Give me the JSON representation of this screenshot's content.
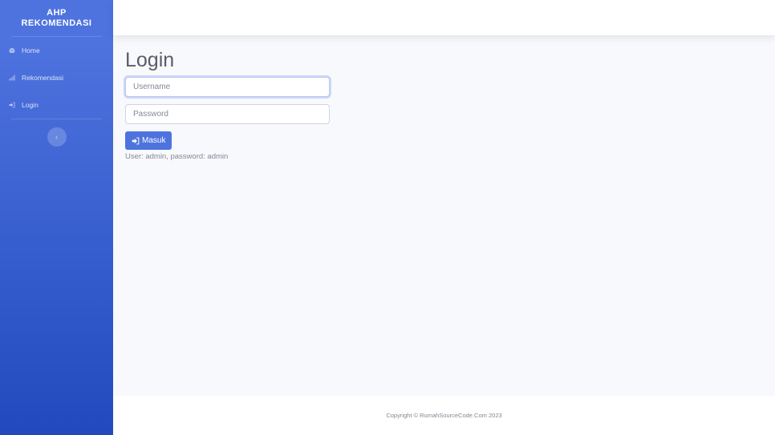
{
  "brand": {
    "line1": "AHP",
    "line2": "REKOMENDASI"
  },
  "sidebar": {
    "items": [
      {
        "label": "Home",
        "icon": "dashboard-icon"
      },
      {
        "label": "Rekomendasi",
        "icon": "signal-bars-icon"
      },
      {
        "label": "Login",
        "icon": "sign-in-icon"
      }
    ],
    "toggle_icon": "chevron-left-icon",
    "toggle_glyph": "‹"
  },
  "login": {
    "title": "Login",
    "username_placeholder": "Username",
    "password_placeholder": "Password",
    "submit_label": "Masuk",
    "hint": "User: admin, password: admin"
  },
  "footer": {
    "text": "Copyright © RumahSourceCode.Com 2023"
  },
  "colors": {
    "primary": "#4e73df",
    "primary_dark": "#224abe",
    "background": "#f8f9fc"
  }
}
